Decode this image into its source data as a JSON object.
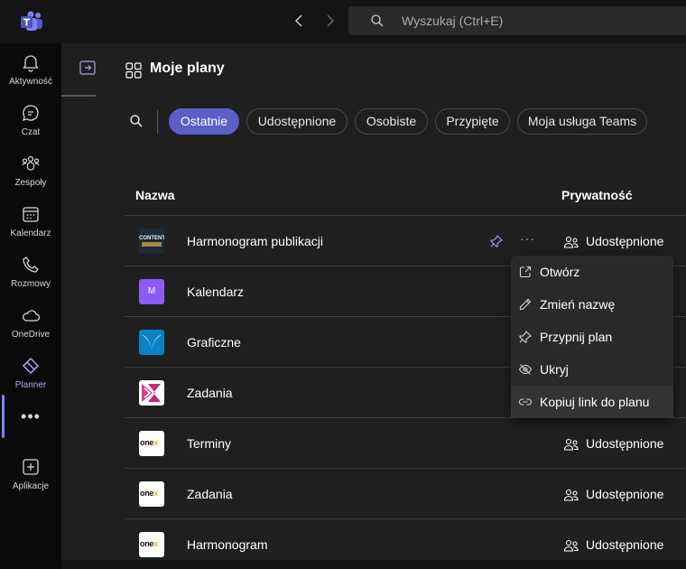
{
  "search": {
    "placeholder": "Wyszukaj (Ctrl+E)"
  },
  "rail": {
    "items": [
      {
        "label": "Aktywność",
        "icon": "bell-icon"
      },
      {
        "label": "Czat",
        "icon": "chat-icon"
      },
      {
        "label": "Zespoły",
        "icon": "teams-icon"
      },
      {
        "label": "Kalendarz",
        "icon": "calendar-icon"
      },
      {
        "label": "Rozmowy",
        "icon": "phone-icon"
      },
      {
        "label": "OneDrive",
        "icon": "cloud-icon"
      },
      {
        "label": "Planner",
        "icon": "planner-icon",
        "active": true
      },
      {
        "label": "Aplikacje",
        "icon": "add-apps-icon"
      }
    ],
    "more": "•••"
  },
  "header": {
    "title": "Moje plany"
  },
  "filters": [
    {
      "label": "Ostatnie",
      "active": true
    },
    {
      "label": "Udostępnione"
    },
    {
      "label": "Osobiste"
    },
    {
      "label": "Przypięte"
    },
    {
      "label": "Moja usługa Teams"
    }
  ],
  "table": {
    "columns": {
      "name": "Nazwa",
      "privacy": "Prywatność"
    },
    "rows": [
      {
        "name": "Harmonogram publikacji",
        "privacy": "Udostępnione",
        "thumb": "CONTENT"
      },
      {
        "name": "Kalendarz",
        "privacy": "",
        "thumb": "M"
      },
      {
        "name": "Graficzne",
        "privacy": ""
      },
      {
        "name": "Zadania",
        "privacy": ""
      },
      {
        "name": "Terminy",
        "privacy": "Udostępnione",
        "thumb": "onex"
      },
      {
        "name": "Zadania",
        "privacy": "Udostępnione",
        "thumb": "onex"
      },
      {
        "name": "Harmonogram",
        "privacy": "Udostępnione",
        "thumb": "onex"
      }
    ],
    "more_label": "···"
  },
  "context_menu": {
    "items": [
      {
        "label": "Otwórz",
        "icon": "open-external-icon"
      },
      {
        "label": "Zmień nazwę",
        "icon": "pencil-icon"
      },
      {
        "label": "Przypnij plan",
        "icon": "pin-icon"
      },
      {
        "label": "Ukryj",
        "icon": "eye-off-icon"
      },
      {
        "label": "Kopiuj link do planu",
        "icon": "link-icon",
        "hovered": true
      }
    ]
  },
  "colors": {
    "accent": "#5b5fc7",
    "accent_light": "#7f85f5",
    "background": "#1f1f1f",
    "rail": "#0a0a0a"
  }
}
